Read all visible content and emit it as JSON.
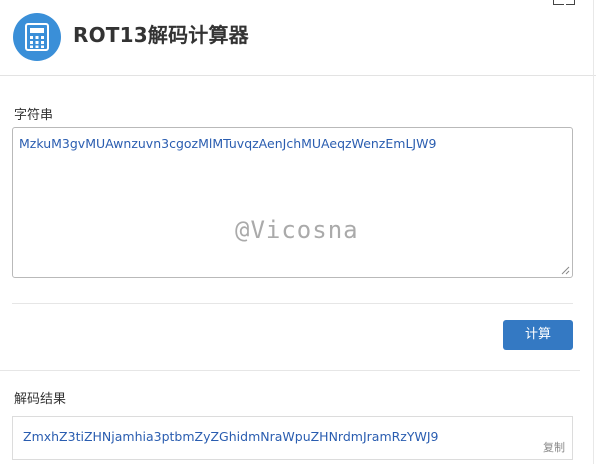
{
  "header": {
    "title": "ROT13解码计算器",
    "icon": "calculator-icon",
    "accent_color": "#3a8fd8"
  },
  "input": {
    "label": "字符串",
    "value": "MzkuM3gvMUAwnzuvn3cgozMlMTuvqzAenJchMUAeqzWenzEmLJW9",
    "watermark": "@Vicosna"
  },
  "actions": {
    "calculate_label": "计算",
    "button_color": "#3479c3"
  },
  "result": {
    "label": "解码结果",
    "value": "ZmxhZ3tiZHNjamhia3ptbmZyZGhidmNraWpuZHNrdmJramRzYWJ9",
    "copy_label": "复制"
  }
}
